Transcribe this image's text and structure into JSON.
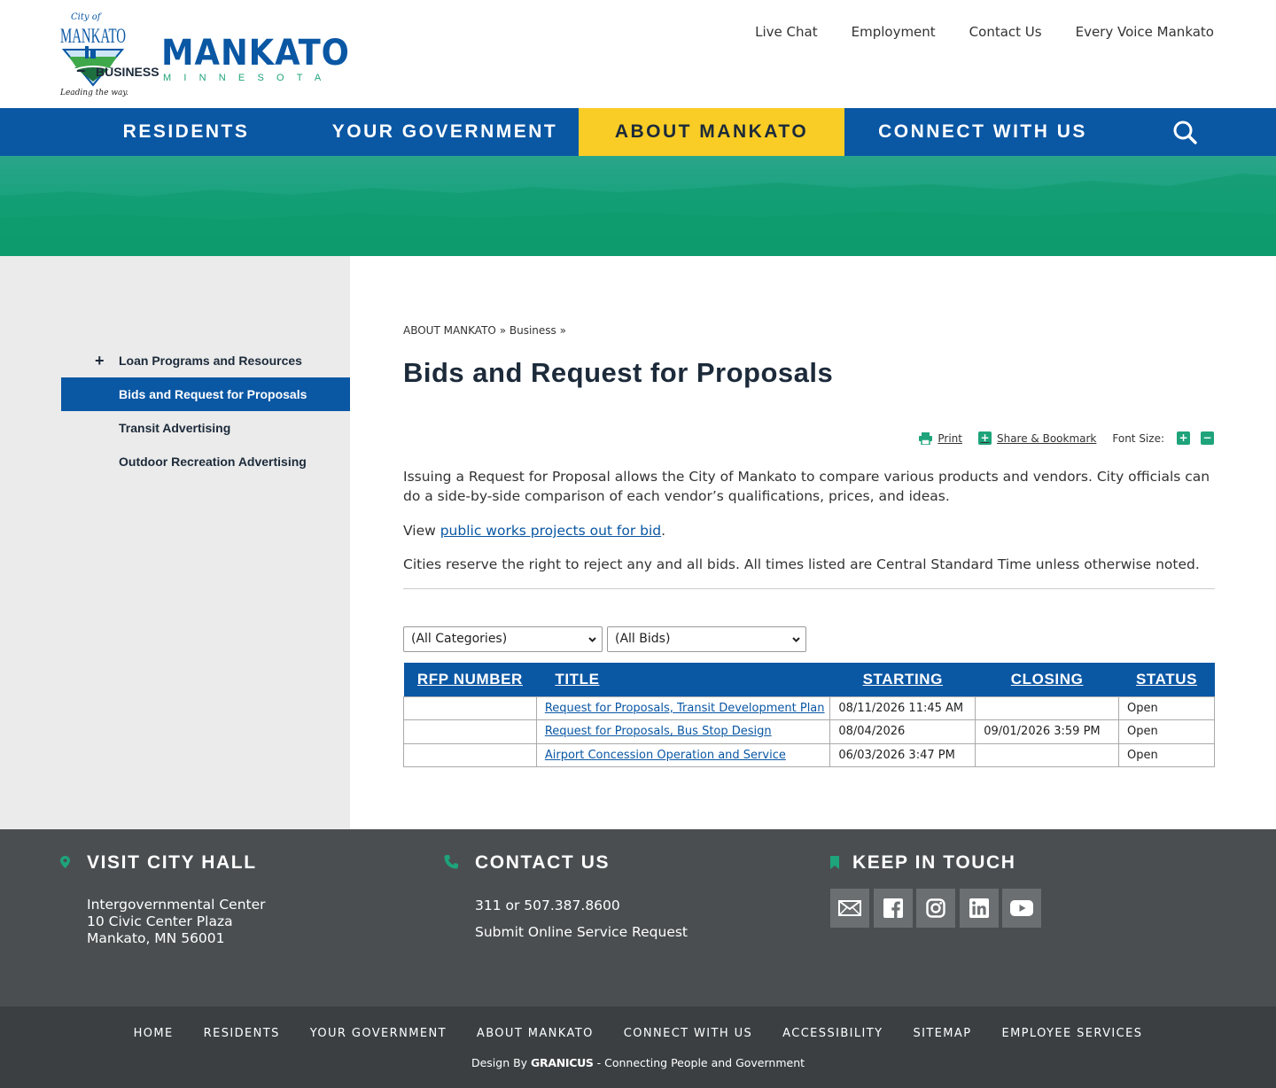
{
  "brand": {
    "seal_script": "City of",
    "seal_name": "MANKATO",
    "seal_tagline": "Leading the way...",
    "wordmark": "MANKATO",
    "state": "MINNESOTA"
  },
  "utility_nav": [
    "Live Chat",
    "Employment",
    "Contact Us",
    "Every Voice Mankato"
  ],
  "main_nav": {
    "items": [
      "RESIDENTS",
      "YOUR GOVERNMENT",
      "ABOUT MANKATO",
      "CONNECT WITH US"
    ],
    "active": "ABOUT MANKATO"
  },
  "sidebar": {
    "section": "BUSINESS",
    "section_symbol": "−",
    "items": [
      {
        "label": "Loan Programs and Resources",
        "symbol": "+"
      },
      {
        "label": "Bids and Request for Proposals",
        "current": true
      },
      {
        "label": "Transit Advertising"
      },
      {
        "label": "Outdoor Recreation Advertising"
      }
    ]
  },
  "breadcrumb": {
    "parts": [
      "ABOUT MANKATO",
      "Business"
    ],
    "separator": "»"
  },
  "page": {
    "title": "Bids and Request for Proposals",
    "tools": {
      "print": "Print",
      "share": "Share & Bookmark",
      "font_size": "Font Size:"
    },
    "intro": "Issuing a Request for Proposal allows the City of Mankato to compare various products and vendors. City officials can do a side-by-side comparison of each vendor’s qualifications, prices, and ideas.",
    "view_prefix": "View ",
    "view_link": "public works projects out for bid",
    "view_suffix": ".",
    "notice": "Cities reserve the right to reject any and all bids. All times listed are Central Standard Time unless otherwise noted."
  },
  "filters": {
    "category": "(All Categories)",
    "status": "(All Bids)"
  },
  "bids_table": {
    "columns": [
      "RFP NUMBER",
      "TITLE",
      "STARTING",
      "CLOSING",
      "STATUS"
    ],
    "rows": [
      {
        "rfp": "",
        "title": "Request for Proposals, Transit Development Plan",
        "starting": "08/11/2026 11:45 AM",
        "closing": "",
        "status": "Open"
      },
      {
        "rfp": "",
        "title": "Request for Proposals, Bus Stop Design",
        "starting": "08/04/2026",
        "closing": "09/01/2026 3:59 PM",
        "status": "Open"
      },
      {
        "rfp": "",
        "title": "Airport Concession Operation and Service",
        "starting": "06/03/2026 3:47 PM",
        "closing": "",
        "status": "Open"
      }
    ]
  },
  "footer": {
    "visit": {
      "heading": "VISIT CITY HALL",
      "lines": [
        "Intergovernmental Center",
        "10 Civic Center Plaza",
        "Mankato, MN 56001"
      ]
    },
    "contact": {
      "heading": "CONTACT US",
      "phone": "311 or 507.387.8600",
      "request": "Submit Online Service Request"
    },
    "keep": {
      "heading": "KEEP IN TOUCH",
      "social": [
        "email-icon",
        "facebook-icon",
        "instagram-icon",
        "linkedin-icon",
        "youtube-icon"
      ]
    },
    "links": [
      "HOME",
      "RESIDENTS",
      "YOUR GOVERNMENT",
      "ABOUT MANKATO",
      "CONNECT WITH US",
      "ACCESSIBILITY",
      "SITEMAP",
      "EMPLOYEE SERVICES"
    ],
    "credit_prefix": "Design By ",
    "credit_brand": "GRANICUS",
    "credit_suffix": " - Connecting People and Government"
  },
  "colors": {
    "brand_blue": "#0a57a4",
    "accent_yellow": "#f9cd25",
    "green": "#1ea37a",
    "footer_gray": "#4a4e51"
  }
}
